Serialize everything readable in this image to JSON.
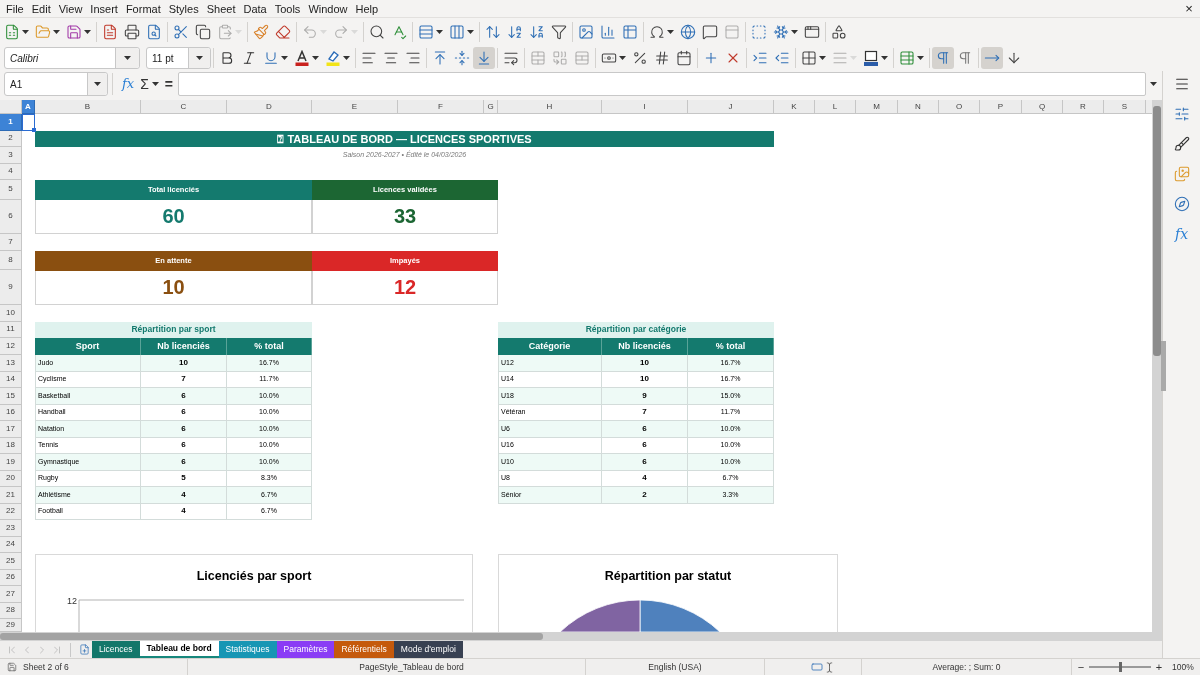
{
  "menu_bar": {
    "items": [
      "File",
      "Edit",
      "View",
      "Insert",
      "Format",
      "Styles",
      "Sheet",
      "Data",
      "Tools",
      "Window",
      "Help"
    ],
    "close": "×"
  },
  "standard_toolbar": [
    {
      "disabled": false
    },
    {
      "disabled": false
    },
    {
      "disabled": false
    },
    {
      "disabled": false
    },
    {
      "disabled": false
    },
    {
      "disabled": false
    },
    {
      "disabled": false
    },
    {
      "disabled": false
    },
    {
      "disabled": true
    },
    {
      "disabled": false
    },
    {
      "disabled": false
    },
    {
      "disabled": true
    },
    {
      "disabled": true
    },
    {
      "disabled": false
    },
    {
      "disabled": false
    },
    {
      "disabled": false
    },
    {
      "disabled": false
    },
    {
      "disabled": false
    },
    {
      "disabled": false
    },
    {
      "disabled": false
    },
    {
      "disabled": false
    },
    {
      "disabled": false
    },
    {
      "disabled": false
    },
    {
      "disabled": false
    },
    {
      "disabled": false
    },
    {
      "disabled": false
    },
    {
      "disabled": false
    },
    {
      "disabled": true
    },
    {
      "disabled": false
    },
    {
      "disabled": false
    },
    {
      "disabled": false
    },
    {
      "disabled": false
    }
  ],
  "formatting_toolbar": {
    "font_name": "Calibri",
    "font_size": "11 pt",
    "buttons": [
      {
        "disabled": false,
        "pressed": false
      },
      {
        "disabled": false,
        "pressed": false
      },
      {
        "disabled": false,
        "pressed": false
      },
      {
        "disabled": false,
        "pressed": false
      },
      {
        "disabled": false,
        "pressed": false
      },
      {
        "disabled": false,
        "pressed": false
      },
      {
        "disabled": false,
        "pressed": false
      },
      {
        "disabled": false,
        "pressed": false
      },
      {
        "disabled": false,
        "pressed": false
      },
      {
        "disabled": false,
        "pressed": false
      },
      {
        "disabled": false,
        "pressed": true
      },
      {
        "disabled": false,
        "pressed": false
      },
      {
        "disabled": true,
        "pressed": false
      },
      {
        "disabled": true,
        "pressed": false
      },
      {
        "disabled": true,
        "pressed": false
      },
      {
        "disabled": false,
        "pressed": false
      },
      {
        "disabled": false,
        "pressed": false
      },
      {
        "disabled": false,
        "pressed": false
      },
      {
        "disabled": false,
        "pressed": false
      },
      {
        "disabled": false,
        "pressed": false
      },
      {
        "disabled": false,
        "pressed": false
      },
      {
        "disabled": false,
        "pressed": false
      },
      {
        "disabled": false,
        "pressed": false
      },
      {
        "disabled": false,
        "pressed": false
      },
      {
        "disabled": true,
        "pressed": false
      },
      {
        "disabled": false,
        "pressed": false
      },
      {
        "disabled": false,
        "pressed": false
      },
      {
        "disabled": false,
        "pressed": true
      },
      {
        "disabled": false,
        "pressed": false
      },
      {
        "disabled": false,
        "pressed": true
      },
      {
        "disabled": false,
        "pressed": false
      }
    ]
  },
  "formula_bar": {
    "name_box": "A1",
    "function_wizard": "fx",
    "sum": "Σ",
    "formula": "="
  },
  "sidebar": {
    "functions": "fx"
  },
  "sheet": {
    "columns": [
      {
        "label": "A",
        "selected": true
      },
      {
        "label": "B",
        "selected": false
      },
      {
        "label": "C",
        "selected": false
      },
      {
        "label": "D",
        "selected": false
      },
      {
        "label": "E",
        "selected": false
      },
      {
        "label": "F",
        "selected": false
      },
      {
        "label": "G",
        "selected": false
      },
      {
        "label": "H",
        "selected": false
      },
      {
        "label": "I",
        "selected": false
      },
      {
        "label": "J",
        "selected": false
      },
      {
        "label": "K",
        "selected": false
      },
      {
        "label": "L",
        "selected": false
      },
      {
        "label": "M",
        "selected": false
      },
      {
        "label": "N",
        "selected": false
      },
      {
        "label": "O",
        "selected": false
      },
      {
        "label": "P",
        "selected": false
      },
      {
        "label": "Q",
        "selected": false
      },
      {
        "label": "R",
        "selected": false
      },
      {
        "label": "S",
        "selected": false
      }
    ],
    "rows": [
      {
        "label": "1",
        "selected": true
      },
      {
        "label": "2",
        "selected": false
      },
      {
        "label": "3",
        "selected": false
      },
      {
        "label": "4",
        "selected": false
      },
      {
        "label": "5",
        "selected": false
      },
      {
        "label": "6",
        "selected": false
      },
      {
        "label": "7",
        "selected": false
      },
      {
        "label": "8",
        "selected": false
      },
      {
        "label": "9",
        "selected": false
      },
      {
        "label": "10",
        "selected": false
      },
      {
        "label": "11",
        "selected": false
      },
      {
        "label": "12",
        "selected": false
      },
      {
        "label": "13",
        "selected": false
      },
      {
        "label": "14",
        "selected": false
      },
      {
        "label": "15",
        "selected": false
      },
      {
        "label": "16",
        "selected": false
      },
      {
        "label": "17",
        "selected": false
      },
      {
        "label": "18",
        "selected": false
      },
      {
        "label": "19",
        "selected": false
      },
      {
        "label": "20",
        "selected": false
      },
      {
        "label": "21",
        "selected": false
      },
      {
        "label": "22",
        "selected": false
      },
      {
        "label": "23",
        "selected": false
      },
      {
        "label": "24",
        "selected": false
      },
      {
        "label": "25",
        "selected": false
      },
      {
        "label": "26",
        "selected": false
      },
      {
        "label": "27",
        "selected": false
      },
      {
        "label": "28",
        "selected": false
      },
      {
        "label": "29",
        "selected": false
      }
    ]
  },
  "dashboard": {
    "title": "⍰ TABLEAU DE BORD — LICENCES SPORTIVES",
    "subtitle": "Saison 2026-2027 • Édité le 04/03/2026",
    "kpis": [
      {
        "label": "Total licenciés",
        "value": "60",
        "color": "#147a6e"
      },
      {
        "label": "Licences validées",
        "value": "33",
        "color": "#1c6633"
      },
      {
        "label": "En attente",
        "value": "10",
        "color": "#8a4f10"
      },
      {
        "label": "Impayés",
        "value": "12",
        "color": "#da2727"
      }
    ],
    "tables": [
      {
        "title": "Répartition par sport",
        "columns": [
          "Sport",
          "Nb licenciés",
          "% total"
        ],
        "rows": [
          [
            "Judo",
            "10",
            "16.7%"
          ],
          [
            "Cyclisme",
            "7",
            "11.7%"
          ],
          [
            "Basketball",
            "6",
            "10.0%"
          ],
          [
            "Handball",
            "6",
            "10.0%"
          ],
          [
            "Natation",
            "6",
            "10.0%"
          ],
          [
            "Tennis",
            "6",
            "10.0%"
          ],
          [
            "Gymnastique",
            "6",
            "10.0%"
          ],
          [
            "Rugby",
            "5",
            "8.3%"
          ],
          [
            "Athlétisme",
            "4",
            "6.7%"
          ],
          [
            "Football",
            "4",
            "6.7%"
          ]
        ]
      },
      {
        "title": "Répartition par catégorie",
        "columns": [
          "Catégorie",
          "Nb licenciés",
          "% total"
        ],
        "rows": [
          [
            "U12",
            "10",
            "16.7%"
          ],
          [
            "U14",
            "10",
            "16.7%"
          ],
          [
            "U18",
            "9",
            "15.0%"
          ],
          [
            "Vétéran",
            "7",
            "11.7%"
          ],
          [
            "U6",
            "6",
            "10.0%"
          ],
          [
            "U16",
            "6",
            "10.0%"
          ],
          [
            "U10",
            "6",
            "10.0%"
          ],
          [
            "U8",
            "4",
            "6.7%"
          ],
          [
            "Sénior",
            "2",
            "3.3%"
          ]
        ]
      }
    ],
    "charts": [
      {
        "kind": "bar",
        "title": "Licenciés par sport",
        "axis_label": "12"
      },
      {
        "kind": "pie",
        "title": "Répartition par statut"
      }
    ]
  },
  "sheet_nav": [
    {
      "disabled": true
    },
    {
      "disabled": true
    },
    {
      "disabled": true
    },
    {
      "disabled": true
    }
  ],
  "sheet_tabs": [
    {
      "label": "Licences",
      "selected": false,
      "color": "#13776a"
    },
    {
      "label": "Tableau de bord",
      "selected": true,
      "color": "#16877c"
    },
    {
      "label": "Statistiques",
      "selected": false,
      "color": "#1796b4"
    },
    {
      "label": "Paramètres",
      "selected": false,
      "color": "#8a3cf5"
    },
    {
      "label": "Référentiels",
      "selected": false,
      "color": "#c55a0c"
    },
    {
      "label": "Mode d'emploi",
      "selected": false,
      "color": "#384152"
    }
  ],
  "status_bar": {
    "sheet_position": "Sheet 2 of 6",
    "page_style": "PageStyle_Tableau de bord",
    "language": "English (USA)",
    "selection_summary": "Average: ; Sum: 0",
    "zoom_out": "−",
    "zoom_slider": {
      "level": 0.5
    },
    "zoom_in": "+",
    "zoom": "100%"
  }
}
